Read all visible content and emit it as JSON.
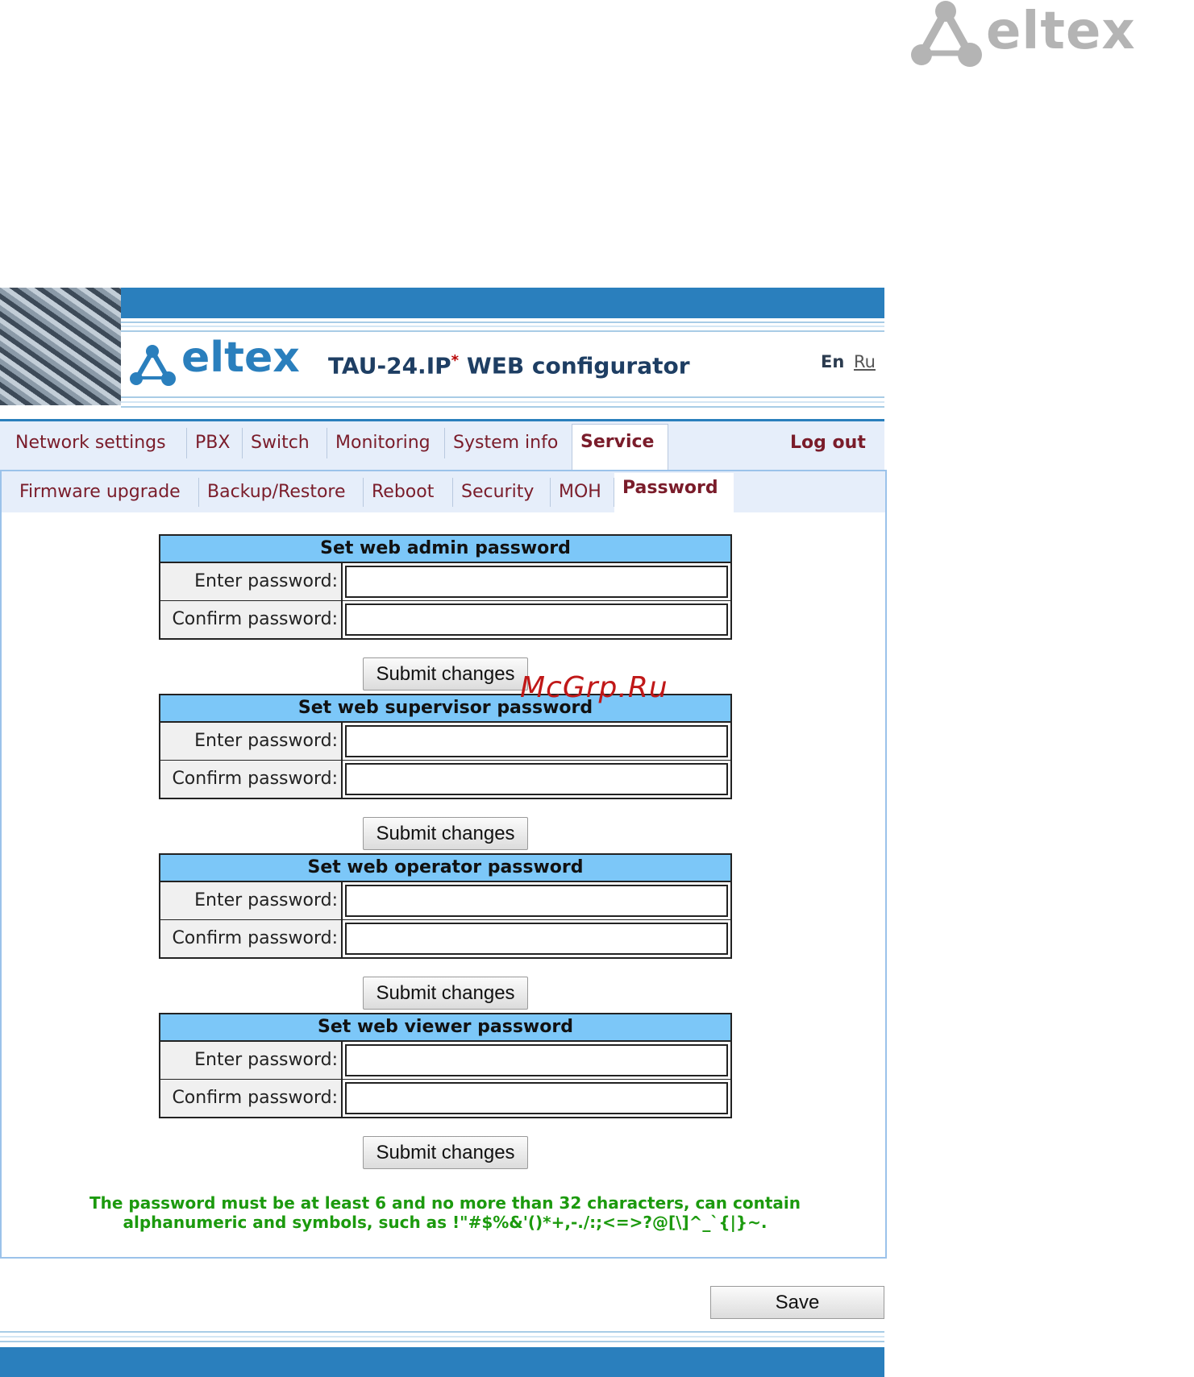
{
  "brand": {
    "corner_logo_text": "eltex",
    "header_logo_text": "eltex",
    "device_title": "TAU-24.IP",
    "title_mark": "*",
    "title_suffix": "WEB configurator"
  },
  "language": {
    "en": "En",
    "ru": "Ru"
  },
  "main_nav": {
    "items": [
      {
        "label": "Network settings"
      },
      {
        "label": "PBX"
      },
      {
        "label": "Switch"
      },
      {
        "label": "Monitoring"
      },
      {
        "label": "System info"
      },
      {
        "label": "Service",
        "active": true
      }
    ],
    "logout": "Log out"
  },
  "sub_nav": {
    "items": [
      {
        "label": "Firmware upgrade"
      },
      {
        "label": "Backup/Restore"
      },
      {
        "label": "Reboot"
      },
      {
        "label": "Security"
      },
      {
        "label": "MOH"
      },
      {
        "label": "Password",
        "active": true
      }
    ]
  },
  "sections": [
    {
      "title": "Set web admin password",
      "enter_label": "Enter password:",
      "confirm_label": "Confirm password:",
      "enter_value": "",
      "confirm_value": "",
      "submit_label": "Submit changes"
    },
    {
      "title": "Set web supervisor password",
      "enter_label": "Enter password:",
      "confirm_label": "Confirm password:",
      "enter_value": "",
      "confirm_value": "",
      "submit_label": "Submit changes"
    },
    {
      "title": "Set web operator password",
      "enter_label": "Enter password:",
      "confirm_label": "Confirm password:",
      "enter_value": "",
      "confirm_value": "",
      "submit_label": "Submit changes"
    },
    {
      "title": "Set web viewer password",
      "enter_label": "Enter password:",
      "confirm_label": "Confirm password:",
      "enter_value": "",
      "confirm_value": "",
      "submit_label": "Submit changes"
    }
  ],
  "note": {
    "line1": "The password must be at least 6 and no more than 32 characters, can contain",
    "line2": "alphanumeric and symbols, such as !\"#$%&'()*+,-./:;<=>?@[\\]^_`{|}~."
  },
  "watermark": "McGrp.Ru",
  "save_label": "Save",
  "colors": {
    "accent_blue": "#2a7fbd",
    "table_header": "#7cc7f8",
    "tab_text": "#7a1c2a",
    "note_green": "#1c9a0e"
  }
}
